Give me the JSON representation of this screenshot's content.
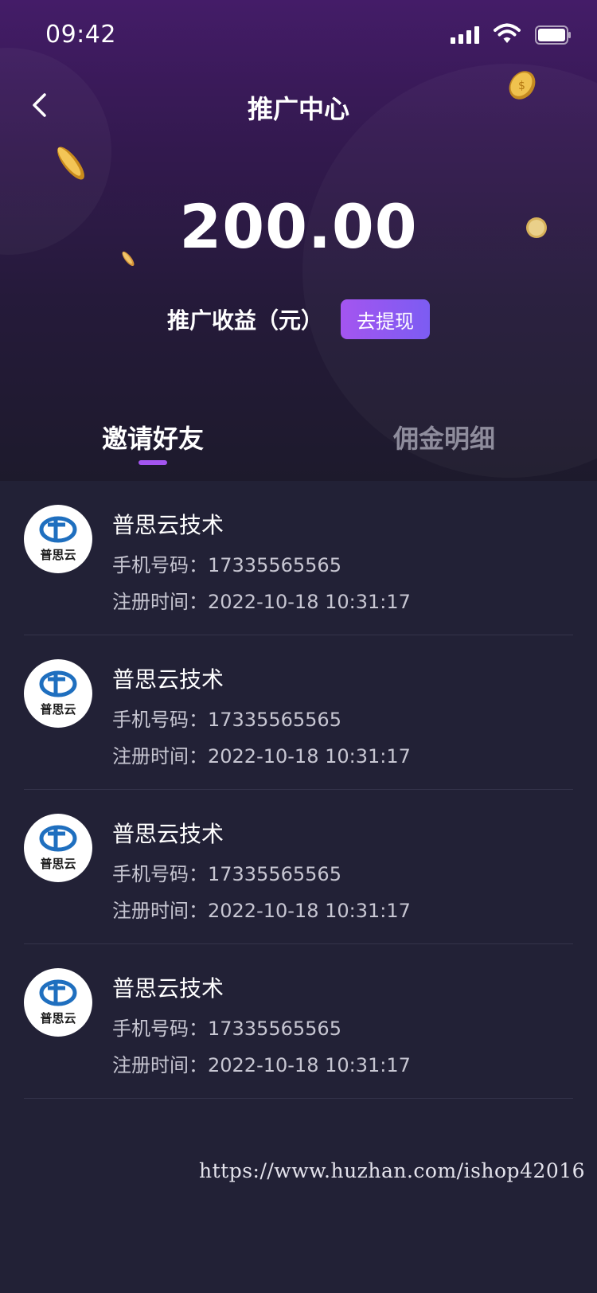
{
  "status_bar": {
    "time": "09:42"
  },
  "header": {
    "title": "推广中心"
  },
  "earnings": {
    "amount": "200.00",
    "label": "推广收益（元）",
    "withdraw_label": "去提现"
  },
  "tabs": [
    {
      "label": "邀请好友",
      "active": true
    },
    {
      "label": "佣金明细",
      "active": false
    }
  ],
  "invitees": [
    {
      "name": "普思云技术",
      "phone": "手机号码：17335565565",
      "reg_time": "注册时间：2022-10-18 10:31:17",
      "avatar_text": "普思云"
    },
    {
      "name": "普思云技术",
      "phone": "手机号码：17335565565",
      "reg_time": "注册时间：2022-10-18 10:31:17",
      "avatar_text": "普思云"
    },
    {
      "name": "普思云技术",
      "phone": "手机号码：17335565565",
      "reg_time": "注册时间：2022-10-18 10:31:17",
      "avatar_text": "普思云"
    },
    {
      "name": "普思云技术",
      "phone": "手机号码：17335565565",
      "reg_time": "注册时间：2022-10-18 10:31:17",
      "avatar_text": "普思云"
    }
  ],
  "watermark": "https://www.huzhan.com/ishop42016",
  "colors": {
    "accent": "#a455f0",
    "background": "#222136",
    "hero_top": "#441c68"
  }
}
